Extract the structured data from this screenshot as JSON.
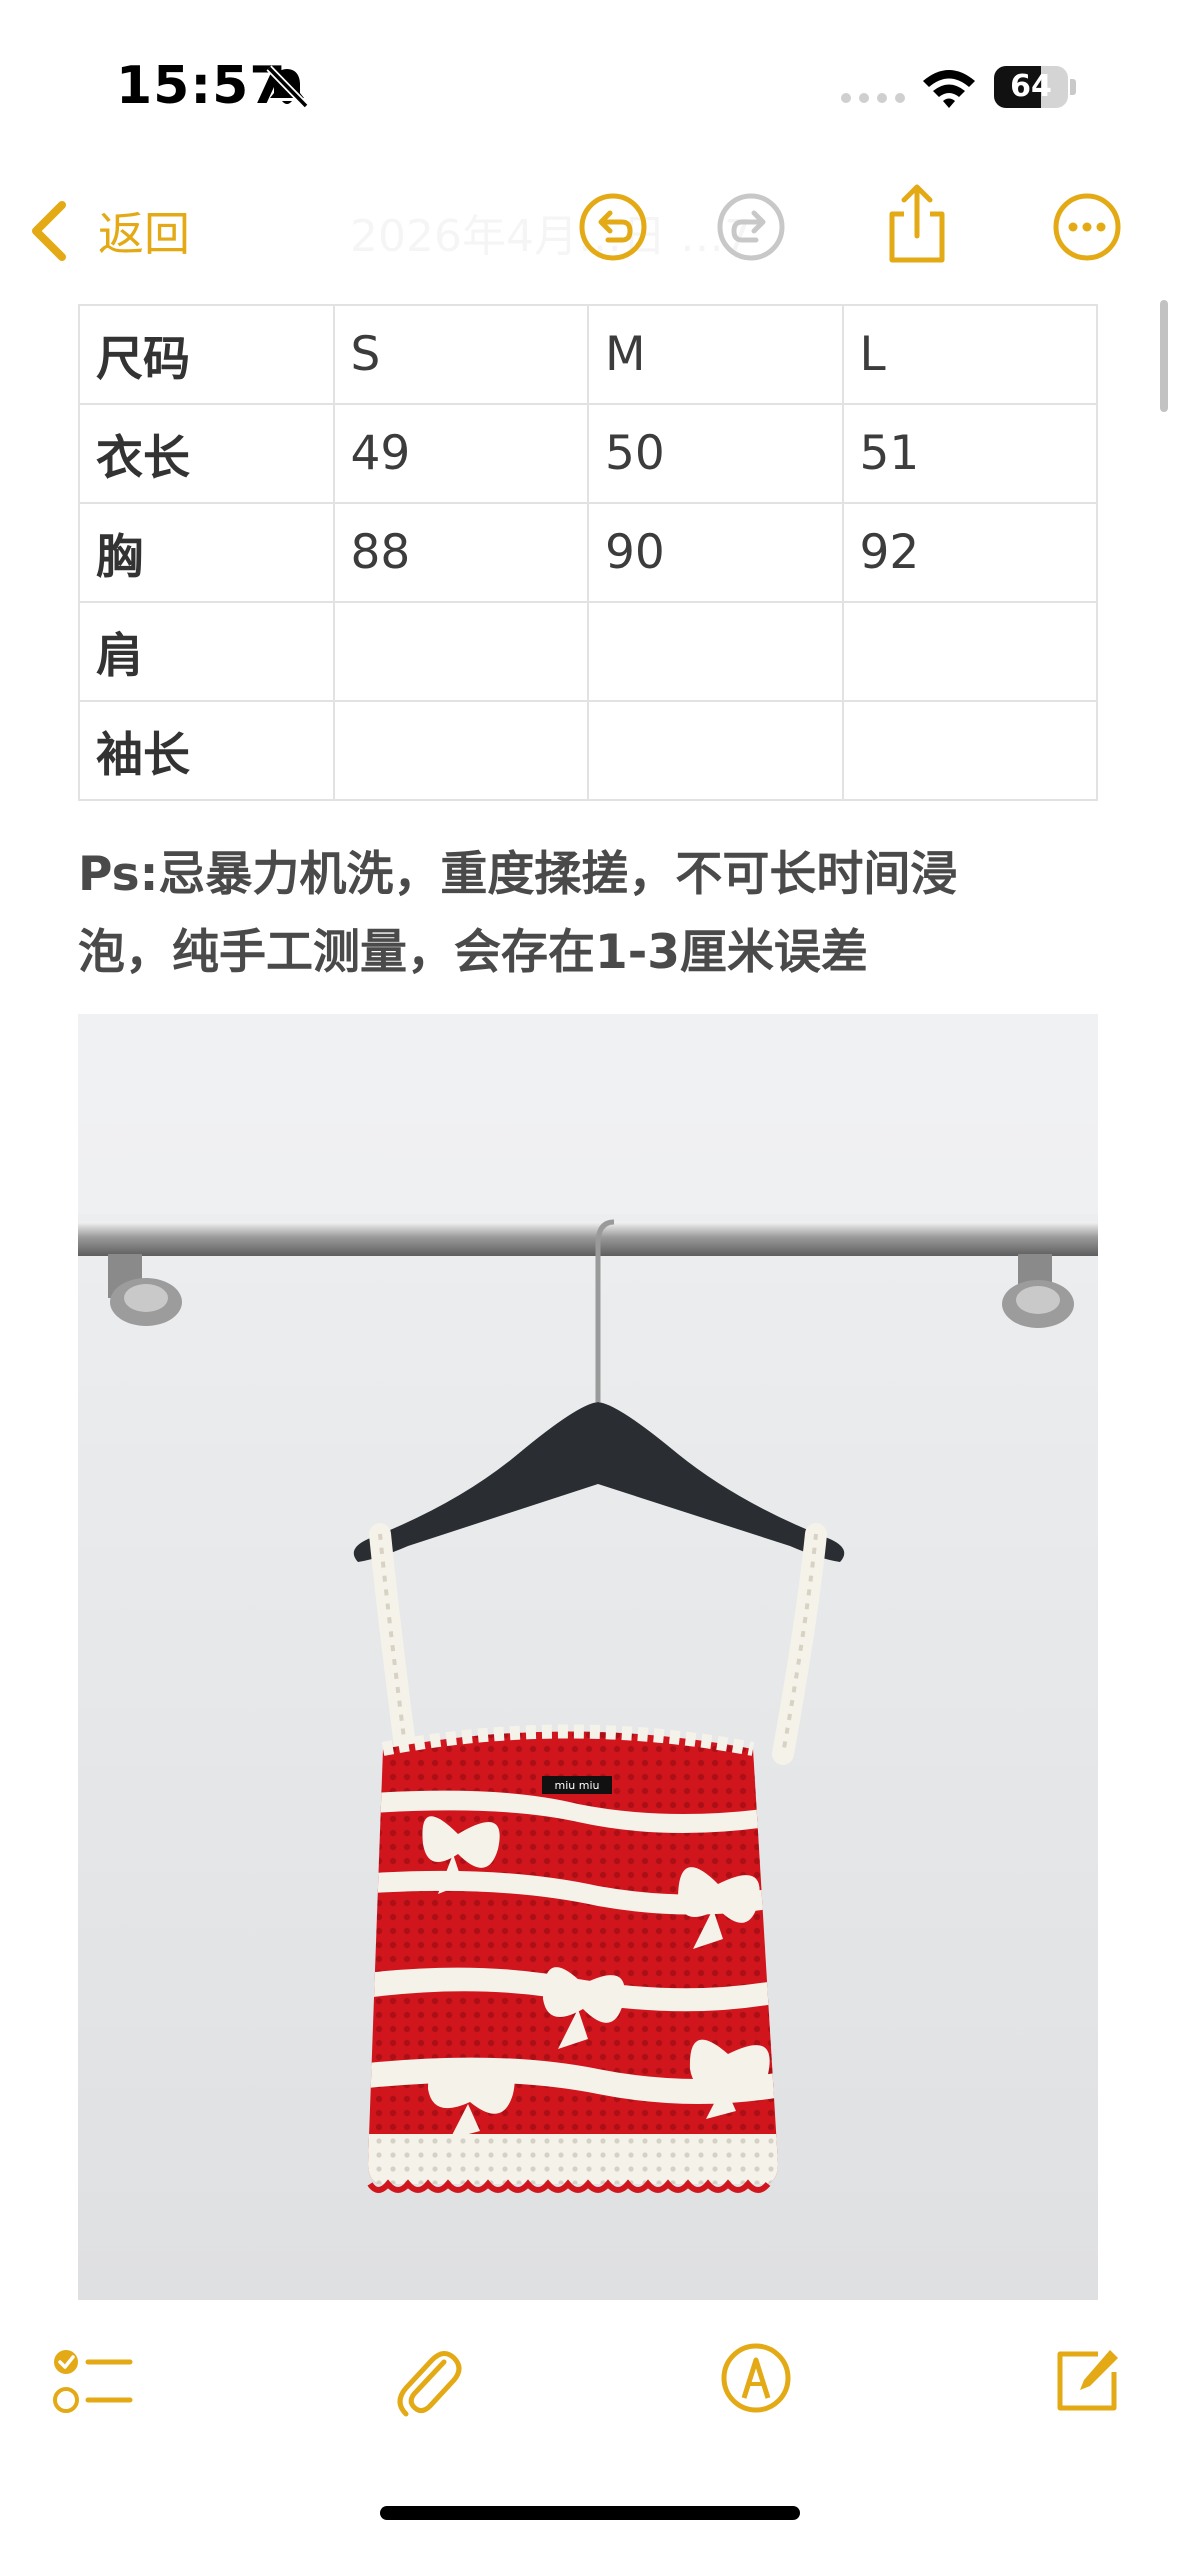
{
  "status_bar": {
    "time": "15:57",
    "battery_level": "64",
    "battery_fraction": 0.64,
    "icons": [
      "bell-slash-icon",
      "cellular-icon",
      "wifi-icon",
      "battery-icon"
    ]
  },
  "nav": {
    "back_label": "返回",
    "date_faded": "2026年4月…日 …7",
    "icons": [
      "chevron-left-icon",
      "undo-icon",
      "redo-icon",
      "share-icon",
      "more-icon"
    ]
  },
  "size_table": {
    "headers": [
      "尺码",
      "S",
      "M",
      "L"
    ],
    "rows": [
      [
        "衣长",
        "49",
        "50",
        "51"
      ],
      [
        "胸",
        "88",
        "90",
        "92"
      ],
      [
        "肩",
        "",
        "",
        ""
      ],
      [
        "袖长",
        "",
        "",
        ""
      ]
    ]
  },
  "note": {
    "line1": "Ps:忌暴力机洗，重度揉搓，不可长时间浸",
    "line2": "泡，纯手工测量，会存在1-3厘米误差"
  },
  "photo": {
    "label_text": "miu miu",
    "colors": {
      "garment_red": "#d0151c",
      "stripe_white": "#f5f2ea",
      "wall": "#e6e7e8",
      "hanger": "#2a2d31"
    }
  },
  "toolbar": {
    "icons": [
      "checklist-icon",
      "paperclip-icon",
      "markup-icon",
      "compose-icon"
    ]
  },
  "theme": {
    "accent": "#e3aa15"
  }
}
